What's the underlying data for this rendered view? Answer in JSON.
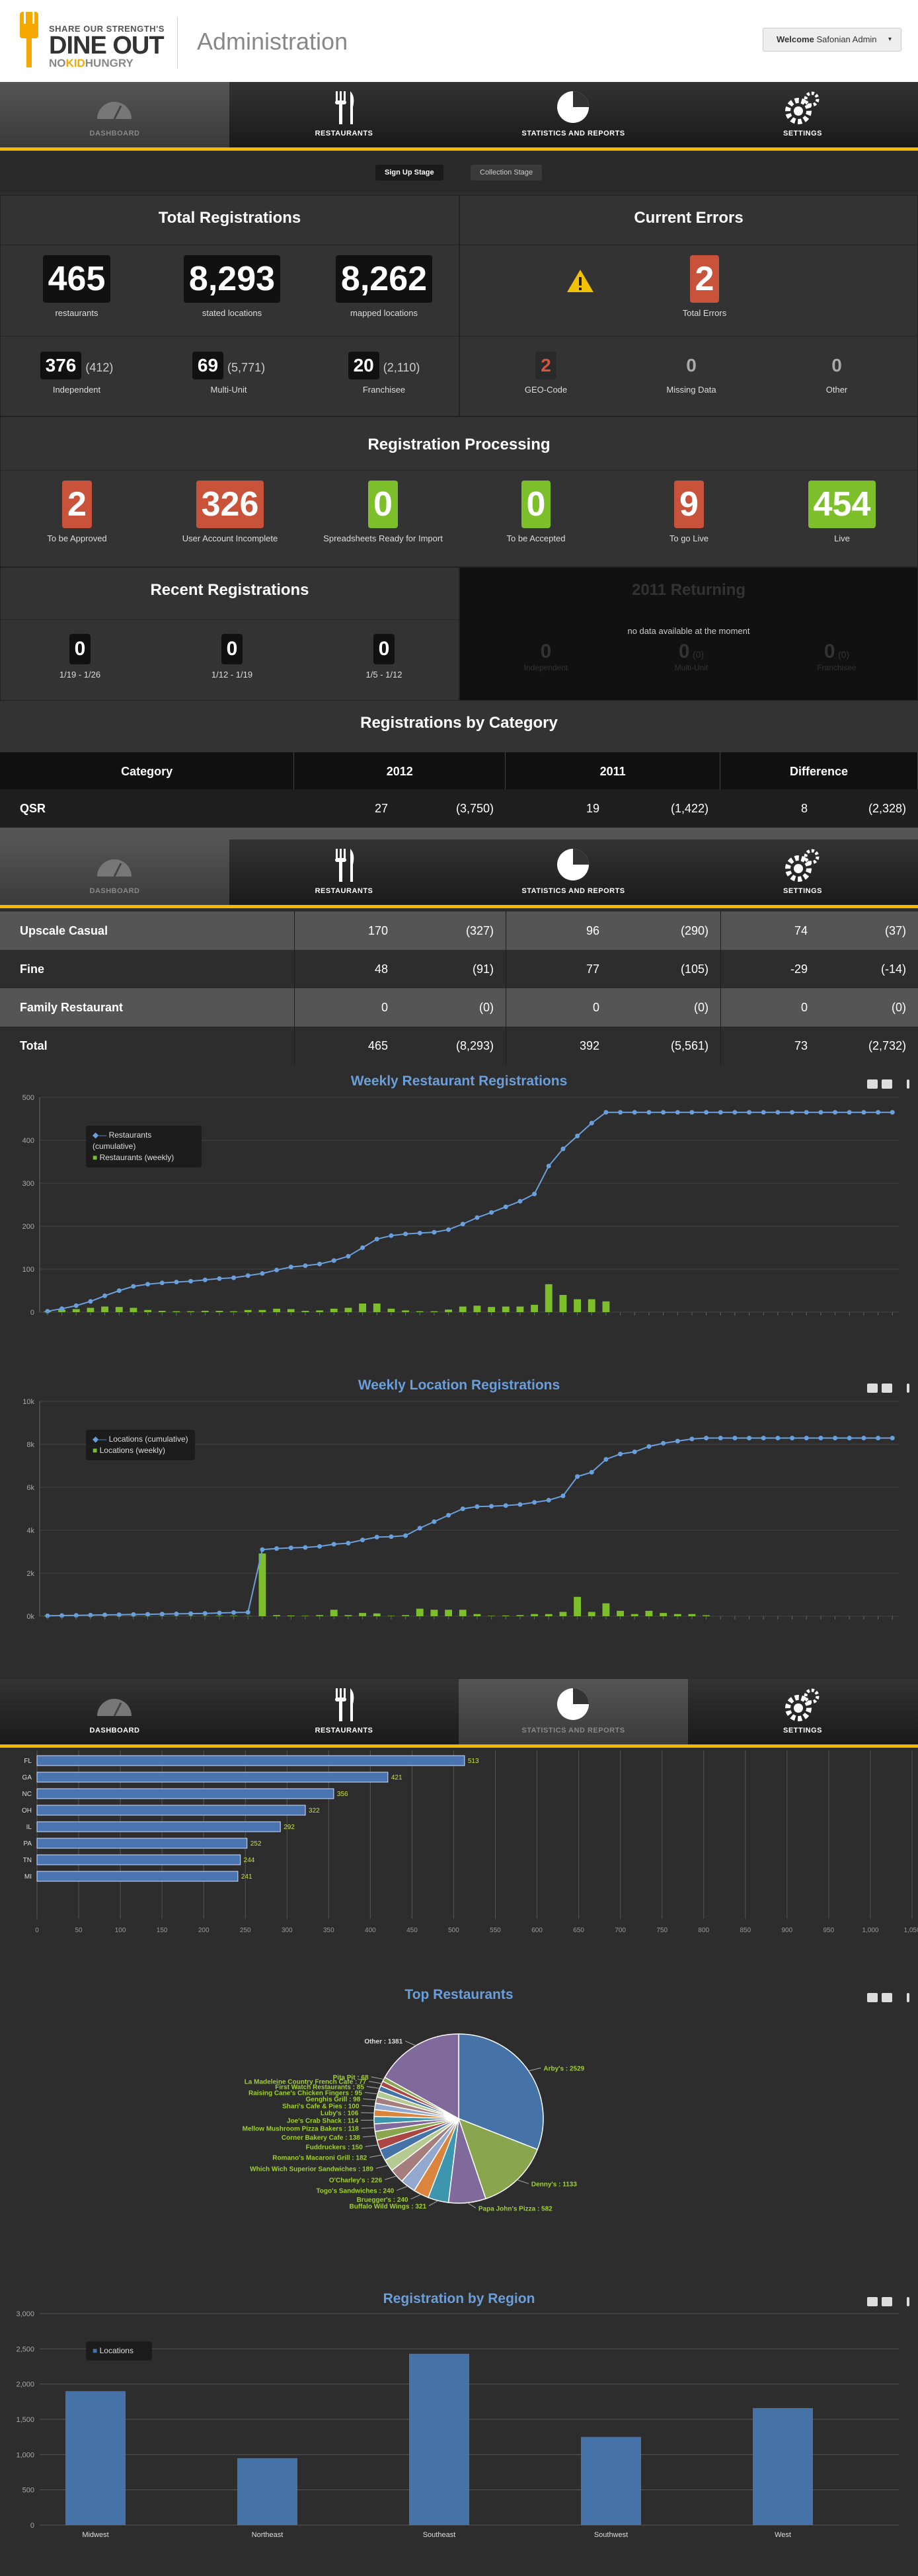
{
  "header": {
    "logo_small": "SHARE OUR STRENGTH'S",
    "logo_big": "DINE OUT",
    "logo_sub_no": "NO",
    "logo_sub_kid": "KID",
    "logo_sub_hungry": "HUNGRY",
    "title": "Administration",
    "welcome_label": "Welcome",
    "welcome_user": "Safonian Admin"
  },
  "nav": {
    "dashboard": "DASHBOARD",
    "restaurants": "RESTAURANTS",
    "stats": "STATISTICS AND REPORTS",
    "settings": "SETTINGS"
  },
  "subnav": {
    "signup": "Sign Up Stage",
    "collection": "Collection Stage"
  },
  "total_registrations": {
    "title": "Total Registrations",
    "restaurants": "465",
    "restaurants_label": "restaurants",
    "stated": "8,293",
    "stated_label": "stated locations",
    "mapped": "8,262",
    "mapped_label": "mapped locations",
    "independent": "376",
    "independent_paren": "(412)",
    "independent_label": "Independent",
    "multi": "69",
    "multi_paren": "(5,771)",
    "multi_label": "Multi-Unit",
    "franchisee": "20",
    "franchisee_paren": "(2,110)",
    "franchisee_label": "Franchisee"
  },
  "current_errors": {
    "title": "Current Errors",
    "total": "2",
    "total_label": "Total Errors",
    "geo": "2",
    "geo_label": "GEO-Code",
    "missing": "0",
    "missing_label": "Missing Data",
    "other": "0",
    "other_label": "Other"
  },
  "processing": {
    "title": "Registration Processing",
    "items": [
      {
        "value": "2",
        "label": "To be Approved"
      },
      {
        "value": "326",
        "label": "User Account Incomplete"
      },
      {
        "value": "0",
        "label": "Spreadsheets Ready for Import"
      },
      {
        "value": "0",
        "label": "To be Accepted"
      },
      {
        "value": "9",
        "label": "To go Live"
      },
      {
        "value": "454",
        "label": "Live"
      }
    ]
  },
  "recent": {
    "title": "Recent Registrations",
    "items": [
      {
        "value": "0",
        "label": "1/19 - 1/26"
      },
      {
        "value": "0",
        "label": "1/12 - 1/19"
      },
      {
        "value": "0",
        "label": "1/5 - 1/12"
      }
    ]
  },
  "returning": {
    "title": "2011 Returning",
    "no_data": "no data available at the moment",
    "independent": "0",
    "independent_label": "Independent",
    "multi": "0",
    "multi_paren": "(0)",
    "multi_label": "Multi-Unit",
    "franchisee": "0",
    "franchisee_paren": "(0)",
    "franchisee_label": "Franchisee"
  },
  "category": {
    "title": "Registrations by Category",
    "headers": [
      "Category",
      "2012",
      "2011",
      "Difference"
    ],
    "rows_top": [
      {
        "name": "QSR",
        "a": "27",
        "ap": "(3,750)",
        "b": "19",
        "bp": "(1,422)",
        "c": "8",
        "cp": "(2,328)"
      }
    ],
    "rows_bottom": [
      {
        "name": "Upscale Casual",
        "a": "170",
        "ap": "(327)",
        "b": "96",
        "bp": "(290)",
        "c": "74",
        "cp": "(37)"
      },
      {
        "name": "Fine",
        "a": "48",
        "ap": "(91)",
        "b": "77",
        "bp": "(105)",
        "c": "-29",
        "cp": "(-14)"
      },
      {
        "name": "Family Restaurant",
        "a": "0",
        "ap": "(0)",
        "b": "0",
        "bp": "(0)",
        "c": "0",
        "cp": "(0)"
      },
      {
        "name": "Total",
        "a": "465",
        "ap": "(8,293)",
        "b": "392",
        "bp": "(5,561)",
        "c": "73",
        "cp": "(2,732)"
      }
    ]
  },
  "chart_data": [
    {
      "type": "line",
      "title": "Weekly Restaurant Registrations",
      "ylim": [
        0,
        500
      ],
      "yticks": [
        "0",
        "100",
        "200",
        "300",
        "400",
        "500"
      ],
      "series": [
        {
          "name": "Restaurants (cumulative)",
          "values": [
            2,
            8,
            15,
            25,
            38,
            50,
            60,
            65,
            68,
            70,
            72,
            75,
            78,
            80,
            85,
            90,
            98,
            105,
            108,
            112,
            120,
            130,
            150,
            170,
            178,
            182,
            184,
            186,
            192,
            205,
            220,
            232,
            245,
            258,
            275,
            340,
            380,
            410,
            440,
            465,
            465,
            465,
            465,
            465,
            465,
            465,
            465,
            465,
            465,
            465,
            465,
            465,
            465,
            465,
            465,
            465,
            465,
            465,
            465,
            465
          ]
        },
        {
          "name": "Restaurants (weekly)",
          "values": [
            2,
            6,
            7,
            10,
            13,
            12,
            10,
            5,
            3,
            2,
            2,
            3,
            3,
            2,
            5,
            5,
            8,
            7,
            3,
            4,
            8,
            10,
            20,
            20,
            8,
            4,
            2,
            2,
            6,
            13,
            15,
            12,
            13,
            13,
            17,
            65,
            40,
            30,
            30,
            25,
            0,
            0,
            0,
            0,
            0,
            0,
            0,
            0,
            0,
            0,
            0,
            0,
            0,
            0,
            0,
            0,
            0,
            0,
            0,
            0
          ]
        }
      ]
    },
    {
      "type": "line",
      "title": "Weekly Location Registrations",
      "ylim": [
        0,
        10000
      ],
      "yticks": [
        "0k",
        "2k",
        "4k",
        "6k",
        "8k",
        "10k"
      ],
      "series": [
        {
          "name": "Locations (cumulative)",
          "values": [
            20,
            30,
            40,
            50,
            60,
            70,
            80,
            90,
            100,
            110,
            120,
            130,
            150,
            170,
            180,
            3100,
            3150,
            3180,
            3200,
            3250,
            3350,
            3400,
            3550,
            3680,
            3700,
            3750,
            4100,
            4400,
            4700,
            5000,
            5100,
            5120,
            5150,
            5200,
            5300,
            5400,
            5600,
            6500,
            6700,
            7300,
            7550,
            7650,
            7900,
            8050,
            8150,
            8250,
            8293,
            8293,
            8293,
            8293,
            8293,
            8293,
            8293,
            8293,
            8293,
            8293,
            8293,
            8293,
            8293,
            8293
          ]
        },
        {
          "name": "Locations (weekly)",
          "values": [
            20,
            10,
            10,
            10,
            10,
            10,
            10,
            10,
            10,
            10,
            10,
            10,
            20,
            20,
            10,
            2920,
            50,
            30,
            20,
            50,
            300,
            50,
            150,
            130,
            20,
            50,
            350,
            300,
            300,
            300,
            100,
            20,
            30,
            50,
            100,
            100,
            200,
            900,
            200,
            600,
            250,
            100,
            250,
            150,
            100,
            100,
            43,
            0,
            0,
            0,
            0,
            0,
            0,
            0,
            0,
            0,
            0,
            0,
            0,
            0
          ]
        }
      ]
    },
    {
      "type": "bar",
      "title": "",
      "categories": [
        "FL",
        "GA",
        "NC",
        "OH",
        "IL",
        "PA",
        "TN",
        "MI"
      ],
      "values": [
        513,
        421,
        356,
        322,
        292,
        252,
        244,
        241
      ],
      "xticks": [
        "0",
        "50",
        "100",
        "150",
        "200",
        "250",
        "300",
        "350",
        "400",
        "450",
        "500",
        "550",
        "600",
        "650",
        "700",
        "750",
        "800",
        "850",
        "900",
        "950",
        "1,000",
        "1,050"
      ]
    },
    {
      "type": "pie",
      "title": "Top Restaurants",
      "slices": [
        {
          "label": "Arby's",
          "value": 2529,
          "color": "#4572a7"
        },
        {
          "label": "Denny's",
          "value": 1133,
          "color": "#89a54e"
        },
        {
          "label": "Papa John's Pizza",
          "value": 582,
          "color": "#80699b"
        },
        {
          "label": "Buffalo Wild Wings",
          "value": 321,
          "color": "#3d96ae"
        },
        {
          "label": "Bruegger's",
          "value": 240,
          "color": "#db843d"
        },
        {
          "label": "Togo's Sandwiches",
          "value": 240,
          "color": "#92a8cd"
        },
        {
          "label": "O'Charley's",
          "value": 226,
          "color": "#a47d7c"
        },
        {
          "label": "Which Wich Superior Sandwiches",
          "value": 189,
          "color": "#b5ca92"
        },
        {
          "label": "Romano's Macaroni Grill",
          "value": 182,
          "color": "#4572a7"
        },
        {
          "label": "Fuddruckers",
          "value": 150,
          "color": "#aa4643"
        },
        {
          "label": "Corner Bakery Cafe",
          "value": 138,
          "color": "#89a54e"
        },
        {
          "label": "Mellow Mushroom Pizza Bakers",
          "value": 118,
          "color": "#80699b"
        },
        {
          "label": "Joe's Crab Shack",
          "value": 114,
          "color": "#3d96ae"
        },
        {
          "label": "Luby's",
          "value": 106,
          "color": "#db843d"
        },
        {
          "label": "Shari's Cafe & Pies",
          "value": 100,
          "color": "#92a8cd"
        },
        {
          "label": "Genghis Grill",
          "value": 98,
          "color": "#a47d7c"
        },
        {
          "label": "Raising Cane's Chicken Fingers",
          "value": 95,
          "color": "#b5ca92"
        },
        {
          "label": "First Watch Restaurants",
          "value": 85,
          "color": "#4572a7"
        },
        {
          "label": "La Madeleine Country French Cafe",
          "value": 77,
          "color": "#aa4643"
        },
        {
          "label": "Pita Pit",
          "value": 68,
          "color": "#89a54e"
        },
        {
          "label": "Other",
          "value": 1381,
          "color": "#80699b"
        }
      ]
    },
    {
      "type": "bar",
      "title": "Registration by Region",
      "categories": [
        "Midwest",
        "Northeast",
        "Southeast",
        "Southwest",
        "West"
      ],
      "series": [
        {
          "name": "Locations",
          "values": [
            1900,
            950,
            2430,
            1250,
            1660
          ]
        }
      ],
      "ylim": [
        0,
        3000
      ],
      "yticks": [
        "0",
        "500",
        "1,000",
        "1,500",
        "2,000",
        "2,500",
        "3,000"
      ]
    }
  ]
}
